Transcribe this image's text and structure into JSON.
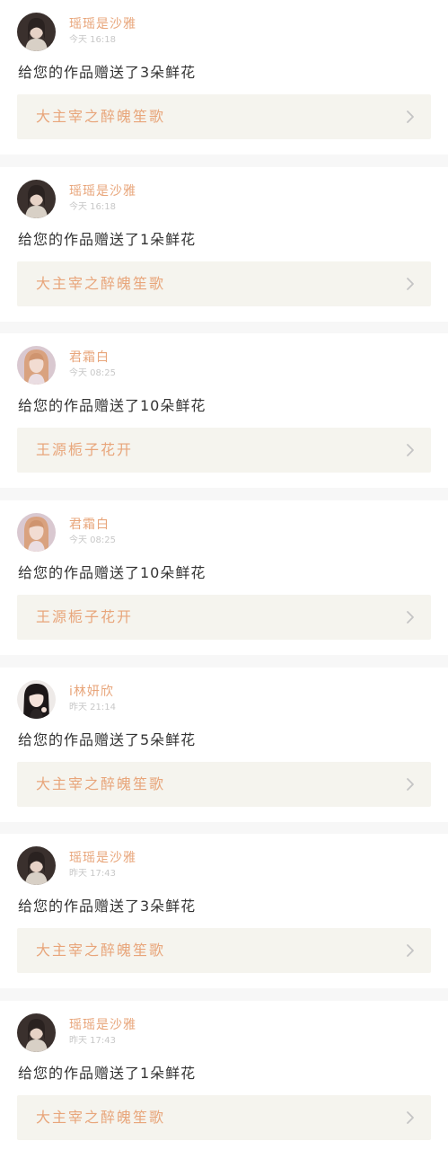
{
  "colors": {
    "accent": "#e8a57a",
    "card_bg": "#f5f4ee",
    "separator": "#f7f7f7",
    "text": "#333333",
    "time": "#c8c8c8"
  },
  "notifications": [
    {
      "avatar": "girl-dark-hair-avatar",
      "username": "瑶瑶是沙雅",
      "time": "今天 16:18",
      "message": "给您的作品赠送了3朵鲜花",
      "work_title": "大主宰之醉魄笙歌"
    },
    {
      "avatar": "girl-dark-hair-avatar",
      "username": "瑶瑶是沙雅",
      "time": "今天 16:18",
      "message": "给您的作品赠送了1朵鲜花",
      "work_title": "大主宰之醉魄笙歌"
    },
    {
      "avatar": "girl-light-hair-avatar",
      "username": "君霜白",
      "time": "今天 08:25",
      "message": "给您的作品赠送了10朵鲜花",
      "work_title": "王源栀子花开"
    },
    {
      "avatar": "girl-light-hair-avatar",
      "username": "君霜白",
      "time": "今天 08:25",
      "message": "给您的作品赠送了10朵鲜花",
      "work_title": "王源栀子花开"
    },
    {
      "avatar": "girl-black-hair-avatar",
      "username": "i林妍欣",
      "time": "昨天 21:14",
      "message": "给您的作品赠送了5朵鲜花",
      "work_title": "大主宰之醉魄笙歌"
    },
    {
      "avatar": "girl-dark-hair-avatar",
      "username": "瑶瑶是沙雅",
      "time": "昨天 17:43",
      "message": "给您的作品赠送了3朵鲜花",
      "work_title": "大主宰之醉魄笙歌"
    },
    {
      "avatar": "girl-dark-hair-avatar",
      "username": "瑶瑶是沙雅",
      "time": "昨天 17:43",
      "message": "给您的作品赠送了1朵鲜花",
      "work_title": "大主宰之醉魄笙歌"
    }
  ]
}
